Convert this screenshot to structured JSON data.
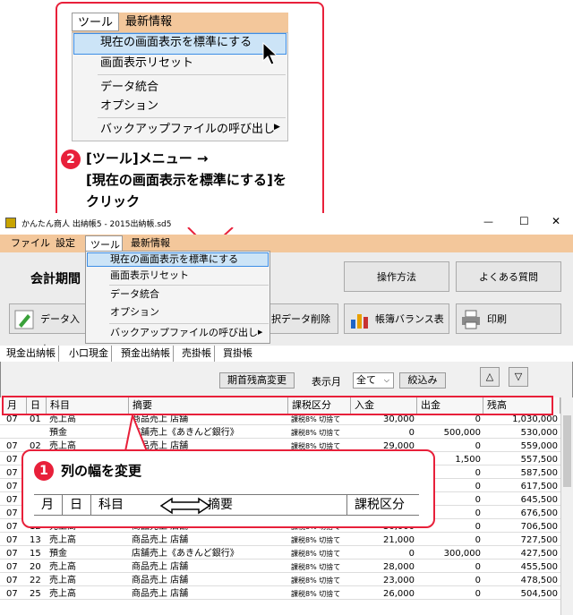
{
  "zoom_menu": {
    "menubar": [
      "ツール",
      "最新情報"
    ],
    "items": [
      "現在の画面表示を標準にする",
      "画面表示リセット",
      "データ統合",
      "オプション",
      "バックアップファイルの呼び出し"
    ]
  },
  "callout2": {
    "badge": "2",
    "line1": "[ツール]メニュー →",
    "line2": "[現在の画面表示を標準にする]を",
    "line3": "クリック"
  },
  "window": {
    "title": "かんたん商人 出納帳5 - 2015出納帳.sd5",
    "controls": [
      "—",
      "☐",
      "✕"
    ],
    "menubar": [
      "ファイル",
      "設定",
      "ツール",
      "最新情報"
    ],
    "period_label": "会計期間",
    "buttons": {
      "data_input": "データ入力",
      "delete": "択データ削除",
      "balance": "帳簿バランス表",
      "print": "印刷",
      "howto": "操作方法",
      "faq": "よくある質問"
    },
    "tabs": [
      "現金出納帳",
      "小口現金",
      "預金出納帳",
      "売掛帳",
      "買掛帳"
    ],
    "period_change": "期首残高変更",
    "display_month_label": "表示月",
    "display_month_value": "全て",
    "filter": "絞込み",
    "up": "△",
    "down": "▽"
  },
  "dropdown": {
    "items": [
      "現在の画面表示を標準にする",
      "画面表示リセット",
      "データ統合",
      "オプション",
      "バックアップファイルの呼び出し"
    ]
  },
  "grid": {
    "headers": [
      "月",
      "日",
      "科目",
      "摘要",
      "課税区分",
      "入金",
      "出金",
      "残高"
    ],
    "rows": [
      [
        "07",
        "01",
        "売上高",
        "商品売上 店舗",
        "課税8% 切捨て",
        "30,000",
        "0",
        "1,030,000"
      ],
      [
        "",
        "",
        "預金",
        "店舗売上《あきんど銀行》",
        "課税8% 切捨て",
        "0",
        "500,000",
        "530,000"
      ],
      [
        "07",
        "02",
        "売上高",
        "商品売上 店舗",
        "課税8% 切捨て",
        "29,000",
        "0",
        "559,000"
      ],
      [
        "07",
        "",
        "",
        "",
        "",
        "",
        "1,500",
        "557,500"
      ],
      [
        "07",
        "",
        "",
        "",
        "",
        "",
        "0",
        "587,500"
      ],
      [
        "07",
        "",
        "",
        "",
        "",
        "",
        "0",
        "617,500"
      ],
      [
        "07",
        "",
        "",
        "",
        "",
        "",
        "0",
        "645,500"
      ],
      [
        "07",
        "",
        "",
        "",
        "",
        "",
        "0",
        "676,500"
      ],
      [
        "07",
        "12",
        "売上高",
        "商品売上 店舗",
        "課税8% 切捨て",
        "30,000",
        "0",
        "706,500"
      ],
      [
        "07",
        "13",
        "売上高",
        "商品売上 店舗",
        "課税8% 切捨て",
        "21,000",
        "0",
        "727,500"
      ],
      [
        "07",
        "15",
        "預金",
        "店舗売上《あきんど銀行》",
        "課税8% 切捨て",
        "0",
        "300,000",
        "427,500"
      ],
      [
        "07",
        "20",
        "売上高",
        "商品売上 店舗",
        "課税8% 切捨て",
        "28,000",
        "0",
        "455,500"
      ],
      [
        "07",
        "22",
        "売上高",
        "商品売上 店舗",
        "課税8% 切捨て",
        "23,000",
        "0",
        "478,500"
      ],
      [
        "07",
        "25",
        "売上高",
        "商品売上 店舗",
        "課税8% 切捨て",
        "26,000",
        "0",
        "504,500"
      ]
    ]
  },
  "callout1": {
    "badge": "1",
    "title": "列の幅を変更",
    "mini_headers": [
      "月",
      "日",
      "科目",
      "摘要",
      "課税区分"
    ]
  },
  "colors": {
    "accent_red": "#e8203a",
    "menubar": "#f3c79b",
    "highlight": "#cce4f7"
  },
  "icons": [
    "pencil-icon",
    "delete-icon",
    "chart-icon",
    "printer-icon",
    "double-arrow-icon",
    "pointer-icon"
  ]
}
